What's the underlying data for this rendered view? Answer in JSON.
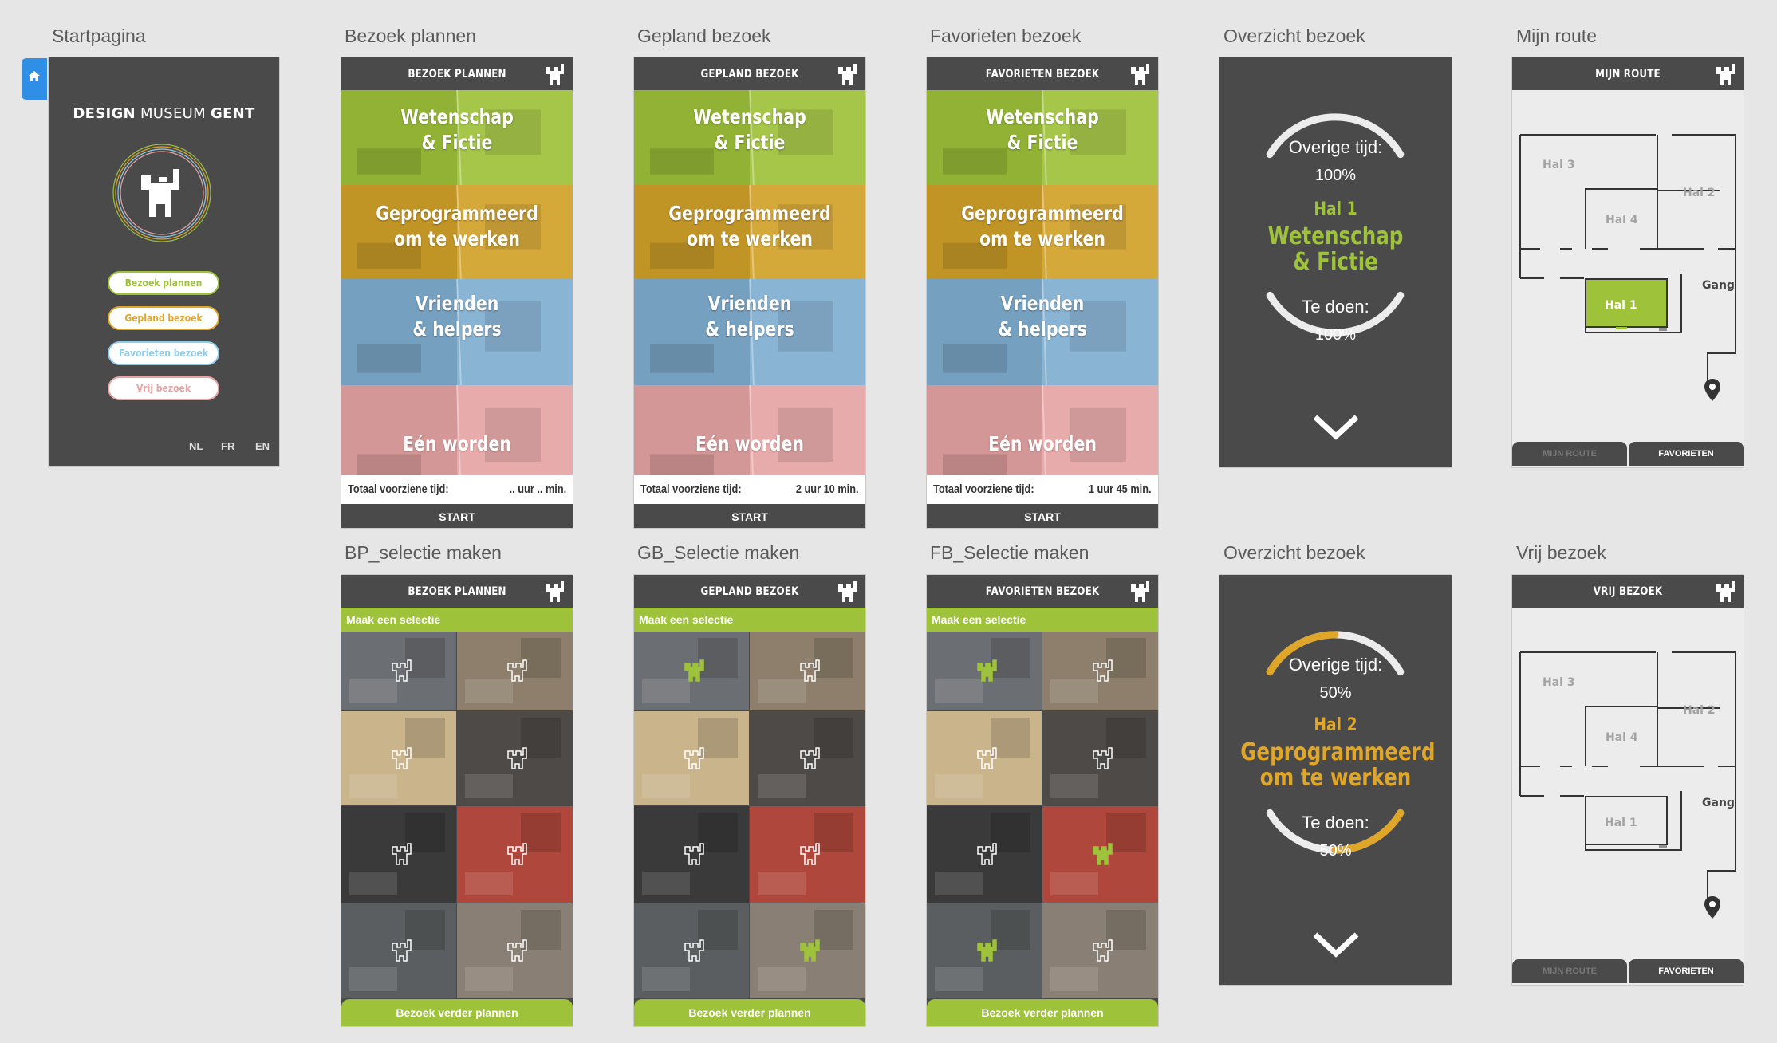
{
  "colors": {
    "dark": "#4a4a4a",
    "green": "#9ec23a",
    "orange": "#e0a62a",
    "blue_light": "#8ecbe8",
    "pink": "#e6a4a4",
    "selected_blue": "#2f8ee6"
  },
  "boards": {
    "start": {
      "title": "Startpagina"
    },
    "plan": {
      "title": "Bezoek plannen"
    },
    "planned": {
      "title": "Gepland bezoek"
    },
    "fav": {
      "title": "Favorieten bezoek"
    },
    "overview1": {
      "title": "Overzicht bezoek"
    },
    "route": {
      "title": "Mijn route"
    },
    "bp_sel": {
      "title": "BP_selectie maken"
    },
    "gb_sel": {
      "title": "GB_Selectie maken"
    },
    "fb_sel": {
      "title": "FB_Selectie maken"
    },
    "overview2": {
      "title": "Overzicht bezoek"
    },
    "free": {
      "title": "Vrij bezoek"
    }
  },
  "start": {
    "museum_1": "DESIGN",
    "museum_2": "MUSEUM",
    "museum_3": "GENT",
    "buttons": [
      "Bezoek plannen",
      "Gepland bezoek",
      "Favorieten bezoek",
      "Vrij bezoek"
    ],
    "languages": [
      "NL",
      "FR",
      "EN"
    ],
    "home_icon": "home-icon"
  },
  "categories": [
    {
      "line1": "Wetenschap",
      "line2": "& Fictie",
      "color": "#9ec23a"
    },
    {
      "line1": "Geprogrammeerd",
      "line2": "om te werken",
      "color": "#d2a12a"
    },
    {
      "line1": "Vrienden",
      "line2": "& helpers",
      "color": "#7faed1"
    },
    {
      "line1": "Eén worden",
      "line2": "",
      "color": "#e6a4a4"
    }
  ],
  "plan_screen": {
    "header": "BEZOEK PLANNEN",
    "total_label": "Totaal voorziene tijd:",
    "total_value": ".. uur .. min.",
    "start": "START"
  },
  "planned_screen": {
    "header": "GEPLAND BEZOEK",
    "total_label": "Totaal voorziene tijd:",
    "total_value": "2 uur 10 min.",
    "start": "START"
  },
  "fav_screen": {
    "header": "FAVORIETEN BEZOEK",
    "total_label": "Totaal voorziene tijd:",
    "total_value": "1 uur 45 min.",
    "start": "START"
  },
  "selection": {
    "bar": "Maak een selectie",
    "plan_button": "Bezoek verder plannen"
  },
  "overview1": {
    "remaining_label": "Overige tijd:",
    "remaining_pct": "100%",
    "hall": "Hal 1",
    "cat_line1": "Wetenschap",
    "cat_line2": "& Fictie",
    "todo_label": "Te doen:",
    "todo_pct": "100%",
    "progress": 0
  },
  "overview2": {
    "remaining_label": "Overige tijd:",
    "remaining_pct": "50%",
    "hall": "Hal 2",
    "cat_line1": "Geprogrammeerd",
    "cat_line2": "om te werken",
    "todo_label": "Te doen:",
    "todo_pct": "50%",
    "progress": 0.5
  },
  "route": {
    "header": "MIJN ROUTE",
    "tab_left": "MIJN ROUTE",
    "tab_right": "FAVORIETEN"
  },
  "free": {
    "header": "VRIJ BEZOEK",
    "tab_left": "MIJN ROUTE",
    "tab_right": "FAVORIETEN"
  },
  "halls": {
    "h1": "Hal 1",
    "h2": "Hal 2",
    "h3": "Hal 3",
    "h4": "Hal 4",
    "gang": "Gang"
  }
}
